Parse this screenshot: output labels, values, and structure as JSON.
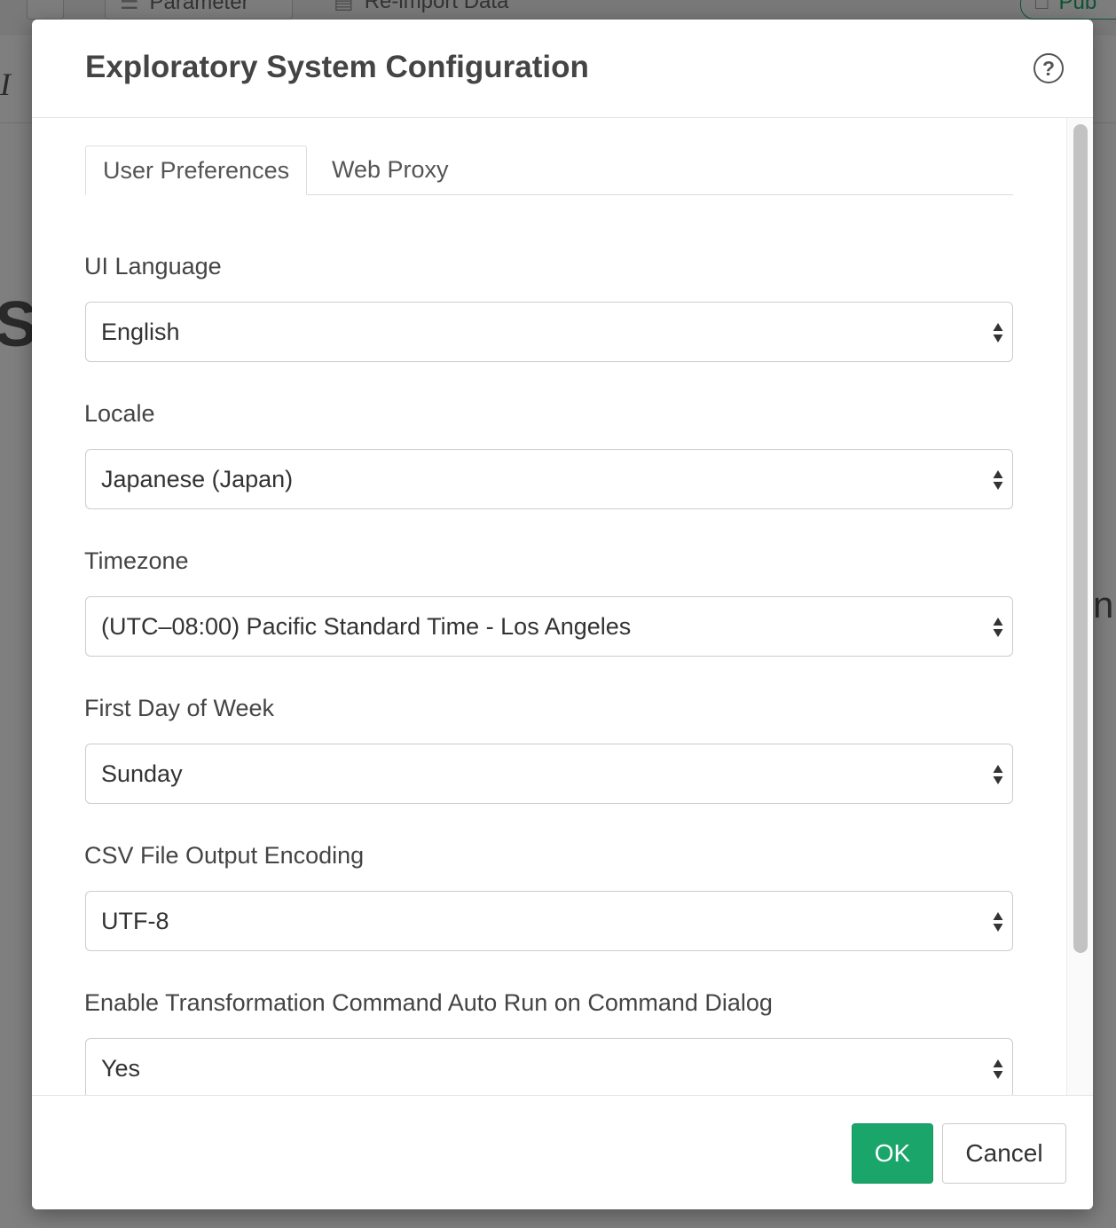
{
  "background": {
    "toolbar_buttons": [
      "Parameter",
      "Re-import Data",
      "Pub"
    ],
    "fragments": [
      "I",
      "S",
      "n"
    ]
  },
  "dialog": {
    "title": "Exploratory System Configuration",
    "help_glyph": "?",
    "tabs": [
      {
        "label": "User Preferences",
        "active": true
      },
      {
        "label": "Web Proxy",
        "active": false
      }
    ],
    "fields": [
      {
        "label": "UI Language",
        "value": "English"
      },
      {
        "label": "Locale",
        "value": "Japanese (Japan)"
      },
      {
        "label": "Timezone",
        "value": "(UTC–08:00) Pacific Standard Time - Los Angeles"
      },
      {
        "label": "First Day of Week",
        "value": "Sunday"
      },
      {
        "label": "CSV File Output Encoding",
        "value": "UTF-8"
      },
      {
        "label": "Enable Transformation Command Auto Run on Command Dialog",
        "value": "Yes"
      }
    ],
    "buttons": {
      "ok": "OK",
      "cancel": "Cancel"
    },
    "colors": {
      "ok_button": "#1aa56b",
      "overlay": "rgba(0,0,0,0.5)"
    }
  }
}
